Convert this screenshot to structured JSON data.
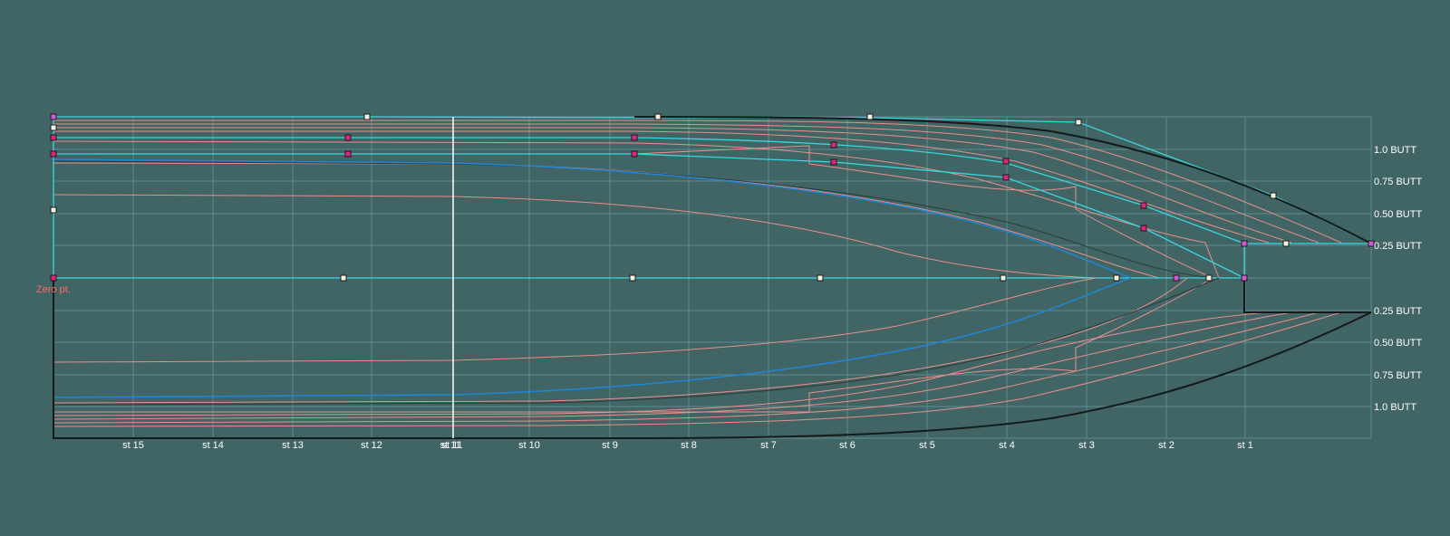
{
  "drawing": {
    "background": "#416464",
    "colors": {
      "grid": "#5a8c91",
      "curve_pink": "#e8908c",
      "curve_blue": "#1e88d8",
      "curve_cyan": "#3ad6e0",
      "outline_black": "#141a1a",
      "curve_dark": "#2c3a3a",
      "station_line": "#ffffff",
      "label_white": "#ffffff",
      "zero_label": "#ff6a6a",
      "point_fill_pink": "#e0247a",
      "point_fill_magenta": "#d656d6",
      "point_fill_light": "#f2f2e0"
    },
    "zero_label": "Zero pt.",
    "station_labels": [
      "st 15",
      "st 14",
      "st 13",
      "st 12",
      "st 11",
      "st 10",
      "st 9",
      "st 8",
      "st 7",
      "st 6",
      "st 5",
      "st 4",
      "st 3",
      "st 2",
      "st 1"
    ],
    "overlapped_station_label": "st 11",
    "butt_labels_upper": [
      "1.0 BUTT",
      "0.75 BUTT",
      "0.50 BUTT",
      "0.25 BUTT"
    ],
    "butt_labels_lower": [
      "0.25 BUTT",
      "0.50 BUTT",
      "0.75 BUTT",
      "1.0 BUTT"
    ]
  }
}
